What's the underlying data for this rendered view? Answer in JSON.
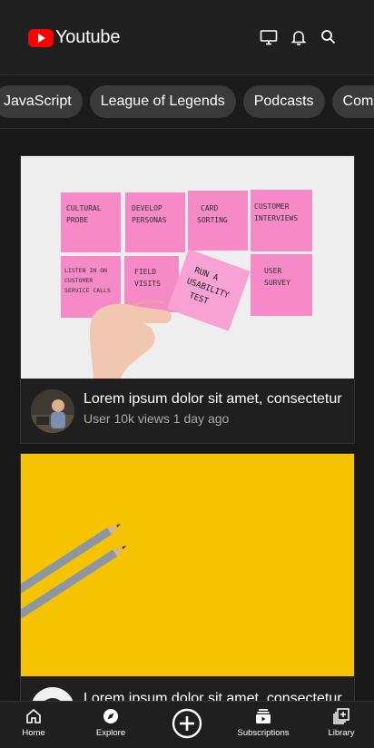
{
  "header": {
    "app_name": "Youtube",
    "icons": [
      "cast-icon",
      "bell-icon",
      "search-icon"
    ]
  },
  "chips": [
    "JavaScript",
    "League of Legends",
    "Podcasts",
    "Comedy"
  ],
  "videos": [
    {
      "title": "Lorem ipsum dolor sit amet, consectetur",
      "subtitle": "User 10k views 1 day ago",
      "sticky_notes": [
        [
          "CULTURAL",
          "PROBE"
        ],
        [
          "DEVELOP",
          "PERSONAS"
        ],
        [
          "CARD",
          "SORTING"
        ],
        [
          "CUSTOMER",
          "INTERVIEWS"
        ],
        [
          "LISTEN IN ON",
          "CUSTOMER",
          "SERVICE CALLS"
        ],
        [
          "FIELD",
          "VISITS"
        ],
        [
          "USER",
          "SURVEY"
        ]
      ],
      "held_note": [
        "RUN A",
        "USABILITY",
        "TEST"
      ]
    },
    {
      "title": "Lorem ipsum dolor sit amet, consectetur",
      "subtitle": ""
    }
  ],
  "bottom_nav": [
    {
      "label": "Home",
      "icon": "home-icon"
    },
    {
      "label": "Explore",
      "icon": "compass-icon"
    },
    {
      "label": "",
      "icon": "add-circle-icon"
    },
    {
      "label": "Subscriptions",
      "icon": "subscriptions-icon"
    },
    {
      "label": "Library",
      "icon": "library-icon"
    }
  ],
  "colors": {
    "brand_red": "#ff0000",
    "background": "#181818",
    "chip_bg": "#3a3a3a"
  }
}
